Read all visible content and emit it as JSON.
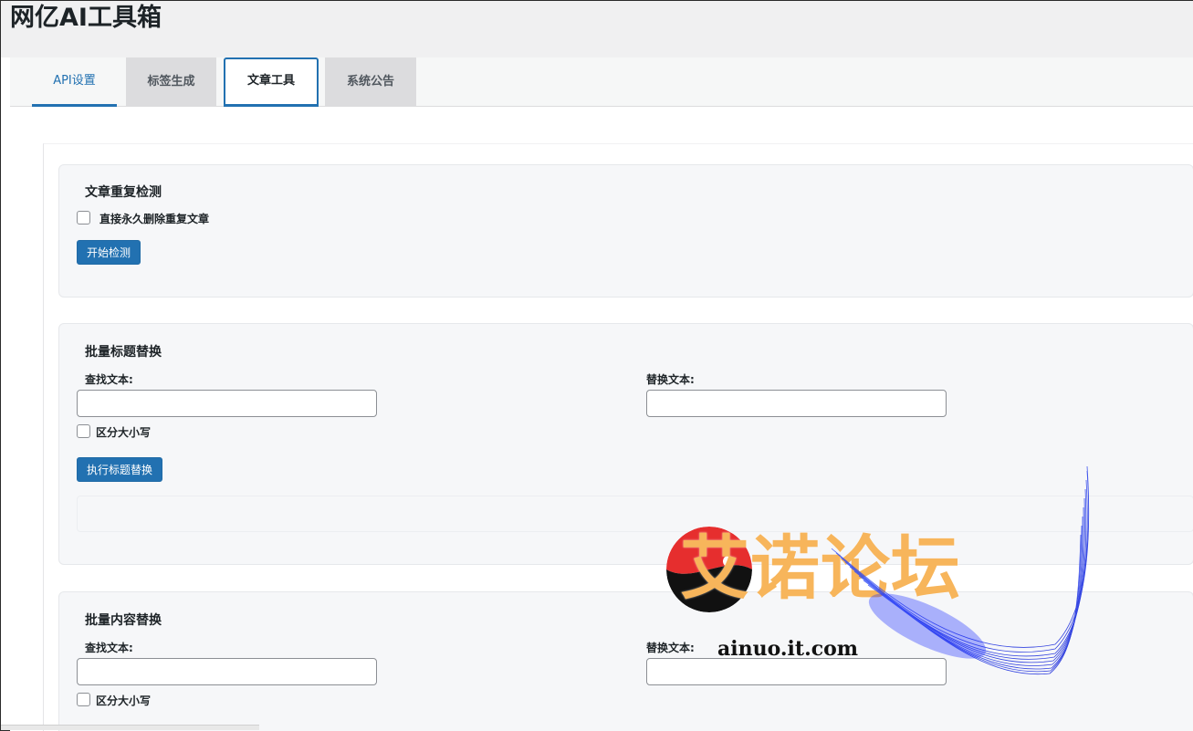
{
  "app": {
    "title": "网亿AI工具箱"
  },
  "tabs": [
    {
      "label": "API设置"
    },
    {
      "label": "标签生成"
    },
    {
      "label": "文章工具"
    },
    {
      "label": "系统公告"
    }
  ],
  "duplicate_check": {
    "title": "文章重复检测",
    "checkbox_label": "直接永久删除重复文章",
    "checked": false,
    "button_label": "开始检测"
  },
  "title_replace": {
    "title": "批量标题替换",
    "find_label": "查找文本:",
    "find_value": "",
    "replace_label": "替换文本:",
    "replace_value": "",
    "case_label": "区分大小写",
    "case_checked": false,
    "button_label": "执行标题替换"
  },
  "content_replace": {
    "title": "批量内容替换",
    "find_label": "查找文本:",
    "find_value": "",
    "replace_label": "替换文本:",
    "replace_value": "",
    "case_label": "区分大小写",
    "case_checked": false
  },
  "watermark": {
    "text": "艾诺论坛",
    "url": "ainuo.it.com"
  },
  "colors": {
    "accent": "#2271b1",
    "card_bg": "#f6f7f9",
    "watermark_text": "#f7b55b"
  }
}
